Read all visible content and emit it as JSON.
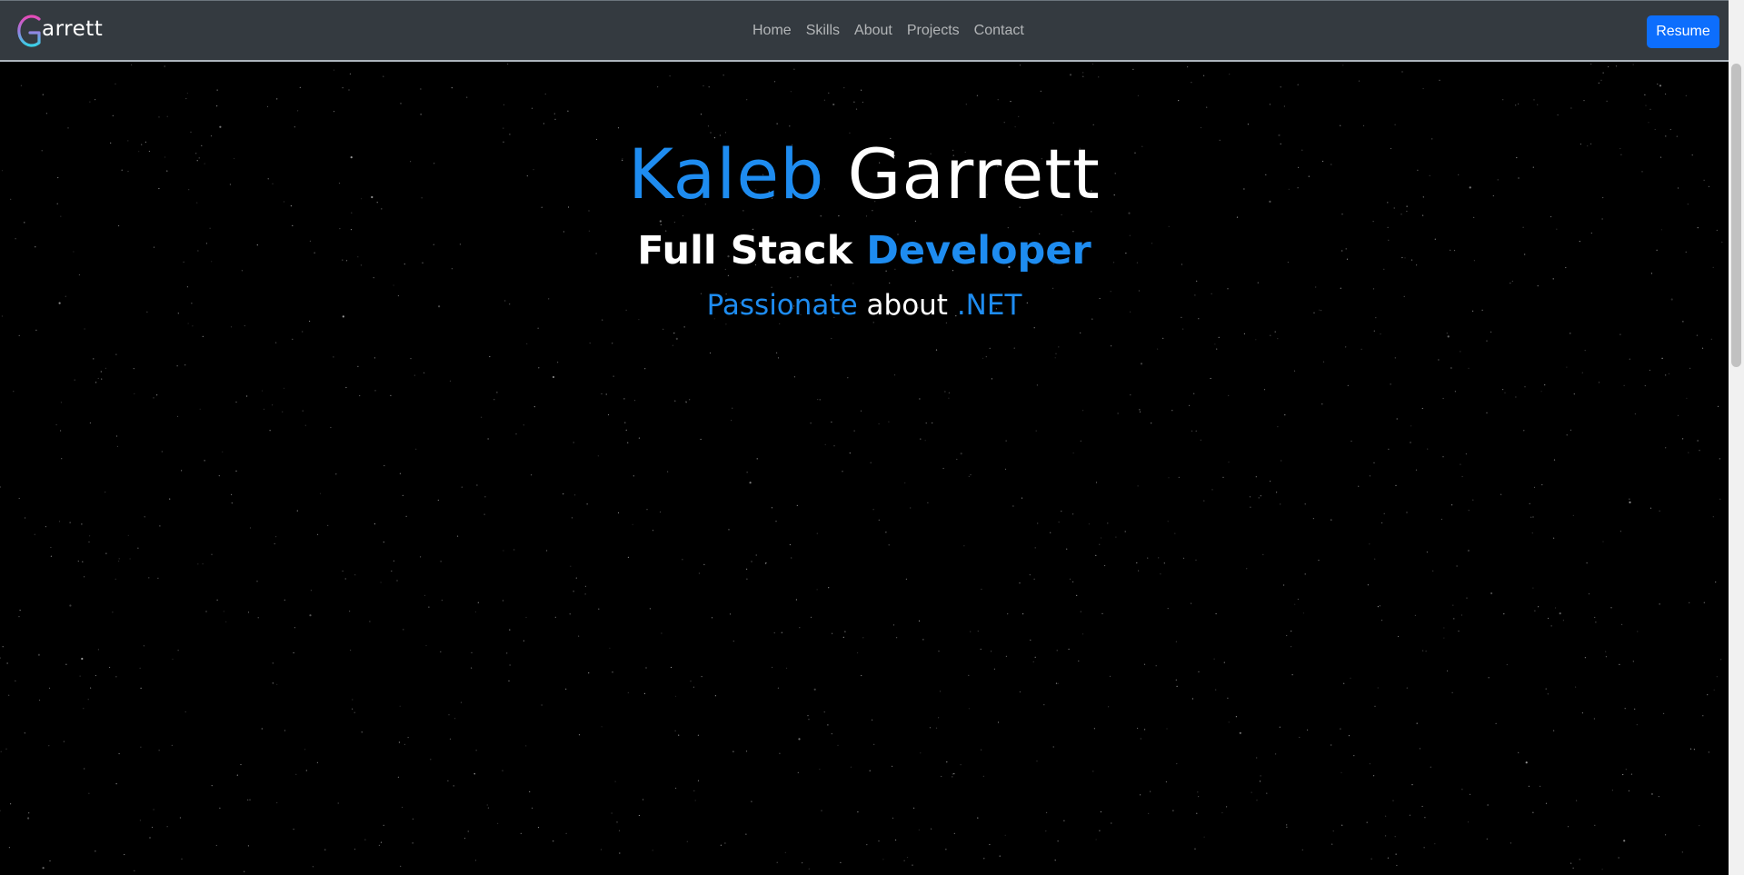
{
  "brand": {
    "logo_letter": "G",
    "text": "arrett"
  },
  "nav": {
    "items": [
      {
        "label": "Home"
      },
      {
        "label": "Skills"
      },
      {
        "label": "About"
      },
      {
        "label": "Projects"
      },
      {
        "label": "Contact"
      }
    ],
    "resume_label": "Resume"
  },
  "hero": {
    "first_name": "Kaleb",
    "last_name": "Garrett",
    "role_first": "Full Stack",
    "role_second": "Developer",
    "tagline_first": "Passionate",
    "tagline_middle": "about",
    "tagline_last": ".NET"
  },
  "colors": {
    "accent": "#1e8cf0",
    "navbar_bg": "#343a40",
    "button_primary": "#0d6efd",
    "hero_bg": "#000000",
    "logo_gradient_start": "#e64bb8",
    "logo_gradient_end": "#39d0e6"
  },
  "icons": {
    "logo": "g-logo-icon",
    "background": "starfield-background"
  }
}
